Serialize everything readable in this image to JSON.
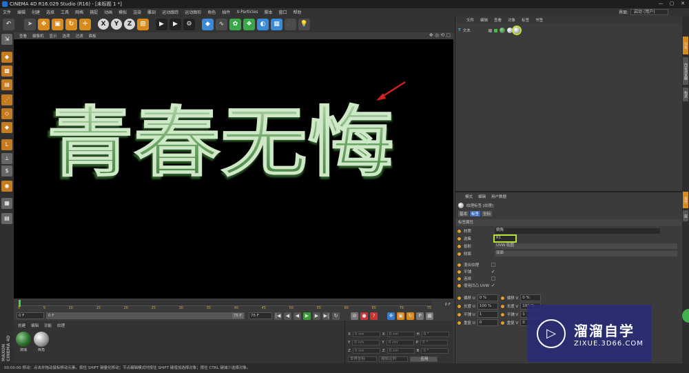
{
  "window": {
    "title": "CINEMA 4D R16.029 Studio (R16) - [未标题 1 *]",
    "controls": [
      "—",
      "▢",
      "✕"
    ]
  },
  "menu": [
    "文件",
    "编辑",
    "创建",
    "选择",
    "工具",
    "网格",
    "捕捉",
    "动画",
    "模拟",
    "渲染",
    "雕刻",
    "运动跟踪",
    "运动图形",
    "角色",
    "插件",
    "X-Particles",
    "脚本",
    "窗口",
    "帮助"
  ],
  "layout": {
    "label": "界面:",
    "value": "启动 (用户)"
  },
  "toolbar": {
    "undo": "↶",
    "axes": [
      "X",
      "Y",
      "Z"
    ]
  },
  "viewport": {
    "menu": [
      "查看",
      "摄像机",
      "显示",
      "选项",
      "过滤",
      "面板"
    ],
    "text": "青春无悔",
    "nav_icons": "✥ ◎ ⟲ ▢"
  },
  "timeline": {
    "ticks": [
      "0",
      "5",
      "10",
      "15",
      "20",
      "25",
      "30",
      "35",
      "40",
      "45",
      "50",
      "55",
      "60",
      "65",
      "70",
      "75"
    ],
    "end_label": "0 F"
  },
  "playbar": {
    "current": "0 F",
    "start": "0 F",
    "end": "75 F",
    "end2": "75 F",
    "buttons": [
      "|◀",
      "◀",
      "◀",
      "▶",
      "▶",
      "▶|",
      "↻"
    ]
  },
  "materials": {
    "menu": [
      "创建",
      "编辑",
      "功能",
      "纹理"
    ],
    "items": [
      {
        "name": "玻璃",
        "color": "#2d6a2f"
      },
      {
        "name": "倒角",
        "color": "#9a9a9a"
      }
    ]
  },
  "brand": "MAXON CINEMA 4D",
  "coordinates": {
    "rows": [
      {
        "a": "X",
        "av": "0 cm",
        "b": "X",
        "bv": "0 cm",
        "c": "H",
        "cv": "0 °"
      },
      {
        "a": "Y",
        "av": "0 cm",
        "b": "Y",
        "bv": "0 cm",
        "c": "P",
        "cv": "0 °"
      },
      {
        "a": "Z",
        "av": "0 cm",
        "b": "Z",
        "bv": "0 cm",
        "c": "B",
        "cv": "0 °"
      }
    ],
    "mode1": "世界坐标",
    "mode2": "缩放比例",
    "apply": "应用"
  },
  "object_manager": {
    "menu": [
      "文件",
      "编辑",
      "查看",
      "对象",
      "标签",
      "书签"
    ],
    "object": {
      "name": "文本",
      "icon": "T"
    }
  },
  "attributes": {
    "menu": [
      "模式",
      "编辑",
      "用户数据"
    ],
    "title": "纹理标签 [纹理]",
    "tabs": [
      "基本",
      "标签",
      "坐标"
    ],
    "section": "标签属性",
    "rows": [
      {
        "label": "材质",
        "value": "倒角"
      },
      {
        "label": "选集",
        "value": "R1"
      },
      {
        "label": "投射",
        "value": "UVW 贴图"
      },
      {
        "label": "侧面",
        "value": "双面"
      }
    ],
    "checks": [
      {
        "label": "混合纹理",
        "checked": false
      },
      {
        "label": "平铺",
        "checked": true
      },
      {
        "label": "连续",
        "checked": false
      },
      {
        "label": "使用凹凸 UVW",
        "checked": true
      }
    ],
    "offsets": [
      {
        "l": "偏移 U",
        "v": "0 %",
        "l2": "偏移 V",
        "v2": "0 %"
      },
      {
        "l": "长度 U",
        "v": "100 %",
        "l2": "长度 V",
        "v2": "100 %"
      },
      {
        "l": "平铺 U",
        "v": "1",
        "l2": "平铺 V",
        "v2": "1"
      },
      {
        "l": "重复 U",
        "v": "0",
        "l2": "重复 V",
        "v2": "0"
      }
    ]
  },
  "side_tabs": [
    "对象",
    "内容浏览器",
    "构造",
    "属性",
    "层"
  ],
  "status": "00:00:00   移动：点击并拖动鼠标移动元素。按住 SHIFT 键量化移动；节点编辑模式时按住 SHIFT 键增加选择对象；按住 CTRL 键减少选择对象。",
  "watermark": {
    "title": "溜溜自学",
    "sub": "ZIXUE.3D66.COM"
  }
}
